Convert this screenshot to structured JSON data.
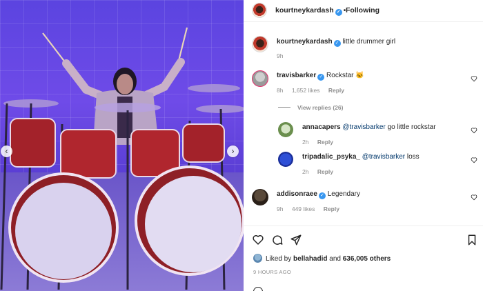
{
  "post": {
    "author": "kourtneykardash",
    "follow_label": "Following",
    "caption": "little drummer girl",
    "caption_time": "9h"
  },
  "comments": [
    {
      "user": "travisbarker",
      "text": "Rockstar 🐱",
      "time": "8h",
      "likes": "1,652 likes",
      "reply": "Reply",
      "view_replies": "View replies (26)"
    },
    {
      "user": "annacapers",
      "mention": "@travisbarker",
      "text": " go little rockstar",
      "time": "2h",
      "reply": "Reply"
    },
    {
      "user": "tripadalic_psyka_",
      "mention": "@travisbarker",
      "text": " loss",
      "time": "2h",
      "reply": "Reply"
    },
    {
      "user": "addisonraee",
      "text": "Legendary",
      "time": "9h",
      "likes": "449 likes",
      "reply": "Reply"
    }
  ],
  "footer": {
    "liked_by_prefix": "Liked by ",
    "liked_by_user": "bellahadid",
    "liked_by_and": " and ",
    "liked_by_count": "636,005 others",
    "timestamp": "9 HOURS AGO"
  },
  "icons": {
    "prev": "chevron-left-icon",
    "next": "chevron-right-icon",
    "like": "heart-icon",
    "comment": "comment-icon",
    "share": "share-icon",
    "save": "bookmark-icon",
    "verified": "verified-badge-icon"
  },
  "colors": {
    "verified": "#3897f0",
    "mention": "#00376b",
    "muted": "#8e8e8e",
    "stage_light": "#6f4be8"
  }
}
